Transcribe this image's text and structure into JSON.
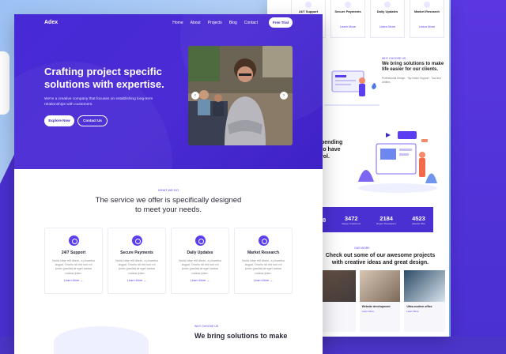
{
  "back_page": {
    "top_cards": [
      {
        "title": "24/7 Support",
        "link": ""
      },
      {
        "title": "Secure Payments",
        "link": "Learn More"
      },
      {
        "title": "Daily Updates",
        "link": "Learn More"
      },
      {
        "title": "Market Research",
        "link": "Learn More"
      }
    ],
    "section2": {
      "kicker": "WHY CHOOSE US",
      "title": "We bring solutions to make life easier for our clients.",
      "body": "Professional Design · Top Notch Support · Tool and Utilities"
    },
    "partial_heading": "pending\nto have\nrol.",
    "stats": [
      {
        "number": "8",
        "label": ""
      },
      {
        "number": "3472",
        "label": "Happy Customers"
      },
      {
        "number": "2184",
        "label": "Expert Developers"
      },
      {
        "number": "4523",
        "label": "Awards Won"
      }
    ],
    "projects": {
      "kicker": "OUR WORK",
      "title": "Check out some of our awesome projects with creative ideas and great design.",
      "cards": [
        {
          "title": "",
          "link": ""
        },
        {
          "title": "Website development",
          "link": "Learn More"
        },
        {
          "title": "Ultra-modern office",
          "link": "Learn More"
        }
      ]
    }
  },
  "front_page": {
    "logo": "Adex",
    "nav": [
      "Home",
      "About",
      "Projects",
      "Blog",
      "Contact"
    ],
    "cta_trial": "Free Trial",
    "hero": {
      "title": "Crafting project specific solutions with expertise.",
      "subtitle": "We're a creative company that focuses on establishing long-term relationships with customers.",
      "explore_label": "Explore Now",
      "contact_label": "Contact Us"
    },
    "services": {
      "kicker": "WHAT WE DO",
      "title": "The service we offer is specifically designed to meet your needs.",
      "cards": [
        {
          "title": "24/7 Support",
          "desc": "Nulla vitae elit libero, a pharetra augue. Donec sit elit non mi porta gravida at eget metus massa justo.",
          "link": "Learn More →"
        },
        {
          "title": "Secure Payments",
          "desc": "Nulla vitae elit libero, a pharetra augue. Donec sit elit non mi porta gravida at eget metus massa justo.",
          "link": "Learn More →"
        },
        {
          "title": "Daily Updates",
          "desc": "Nulla vitae elit libero, a pharetra augue. Donec sit elit non mi porta gravida at eget metus massa justo.",
          "link": "Learn More →"
        },
        {
          "title": "Market Research",
          "desc": "Nulla vitae elit libero, a pharetra augue. Donec sit elit non mi porta gravida at eget metus massa justo.",
          "link": "Learn More →"
        }
      ]
    },
    "bottom": {
      "kicker": "WHY CHOOSE US",
      "partial_title": "We bring solutions to make"
    }
  }
}
